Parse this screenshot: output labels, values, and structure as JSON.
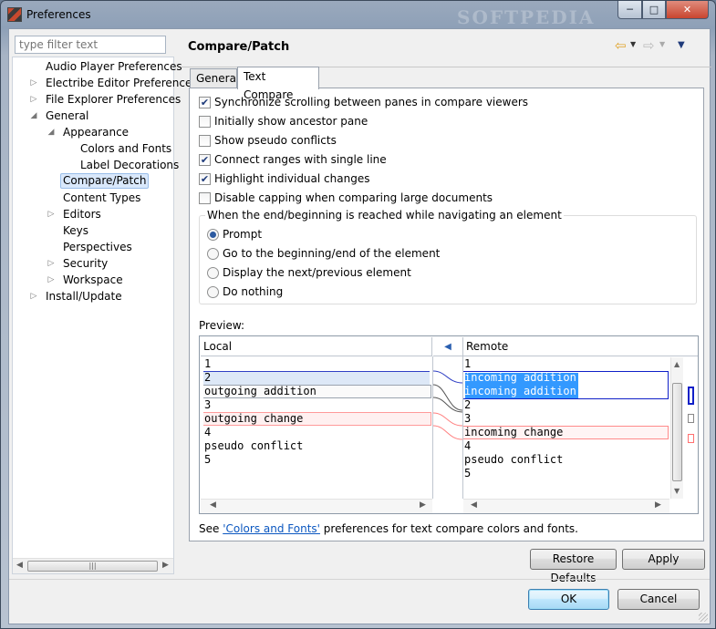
{
  "window": {
    "title": "Preferences",
    "watermark": "SOFTPEDIA"
  },
  "filter": {
    "placeholder": "type filter text"
  },
  "tree": [
    {
      "label": "Audio Player Preferences",
      "level": 1,
      "arrow": ""
    },
    {
      "label": "Electribe Editor Preferences",
      "level": 1,
      "arrow": "collapsed"
    },
    {
      "label": "File Explorer Preferences",
      "level": 1,
      "arrow": "collapsed"
    },
    {
      "label": "General",
      "level": 1,
      "arrow": "expanded"
    },
    {
      "label": "Appearance",
      "level": 2,
      "arrow": "expanded"
    },
    {
      "label": "Colors and Fonts",
      "level": 3,
      "arrow": ""
    },
    {
      "label": "Label Decorations",
      "level": 3,
      "arrow": ""
    },
    {
      "label": "Compare/Patch",
      "level": 2,
      "arrow": "",
      "selected": true
    },
    {
      "label": "Content Types",
      "level": 2,
      "arrow": ""
    },
    {
      "label": "Editors",
      "level": 2,
      "arrow": "collapsed"
    },
    {
      "label": "Keys",
      "level": 2,
      "arrow": ""
    },
    {
      "label": "Perspectives",
      "level": 2,
      "arrow": ""
    },
    {
      "label": "Security",
      "level": 2,
      "arrow": "collapsed"
    },
    {
      "label": "Workspace",
      "level": 2,
      "arrow": "collapsed"
    },
    {
      "label": "Install/Update",
      "level": 1,
      "arrow": "collapsed"
    }
  ],
  "page": {
    "title": "Compare/Patch",
    "tabs": {
      "general": "General",
      "text_compare": "Text Compare"
    },
    "checkboxes": [
      {
        "label": "Synchronize scrolling between panes in compare viewers",
        "checked": true
      },
      {
        "label": "Initially show ancestor pane",
        "checked": false
      },
      {
        "label": "Show pseudo conflicts",
        "checked": false
      },
      {
        "label": "Connect ranges with single line",
        "checked": true
      },
      {
        "label": "Highlight individual changes",
        "checked": true
      },
      {
        "label": "Disable capping when comparing large documents",
        "checked": false
      }
    ],
    "group_title": "When the end/beginning is reached while navigating an element",
    "radios": [
      {
        "label": "Prompt",
        "selected": true
      },
      {
        "label": "Go to the beginning/end of the element",
        "selected": false
      },
      {
        "label": "Display the next/previous element",
        "selected": false
      },
      {
        "label": "Do nothing",
        "selected": false
      }
    ],
    "preview_label": "Preview:",
    "preview": {
      "local_title": "Local",
      "remote_title": "Remote",
      "local_lines": [
        "1",
        "2",
        "outgoing addition",
        "3",
        "outgoing change",
        "4",
        "pseudo conflict",
        "5"
      ],
      "remote_lines": [
        "1",
        "incoming addition",
        "incoming addition",
        "2",
        "3",
        "incoming change",
        "4",
        "pseudo conflict",
        "5"
      ],
      "colors": {
        "outgoing": "#0000ff",
        "incoming_change": "#ff8080",
        "selection": "#3399ff"
      }
    },
    "footer": {
      "see": "See ",
      "link": "'Colors and Fonts'",
      "rest": " preferences for text compare colors and fonts."
    },
    "buttons": {
      "restore": "Restore Defaults",
      "apply": "Apply"
    }
  },
  "dialog_buttons": {
    "ok": "OK",
    "cancel": "Cancel"
  }
}
